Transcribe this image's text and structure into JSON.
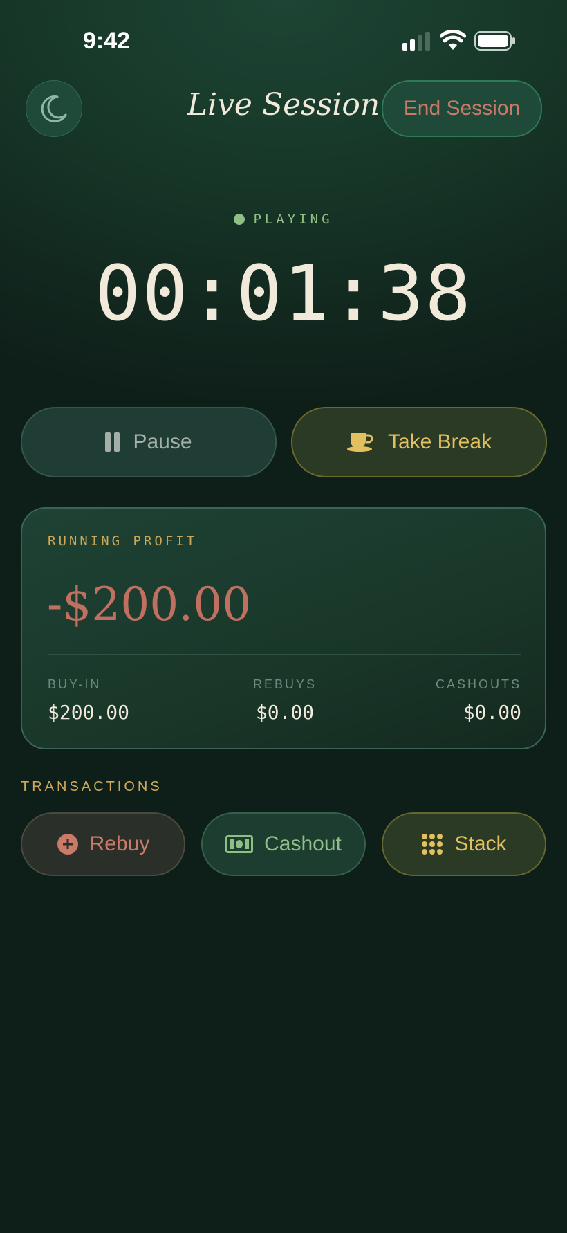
{
  "status_bar": {
    "time": "9:42"
  },
  "header": {
    "title": "Live Session",
    "end_label": "End Session"
  },
  "session": {
    "status": "PLAYING",
    "timer": "00:01:38"
  },
  "actions": {
    "pause_label": "Pause",
    "break_label": "Take Break"
  },
  "profit_card": {
    "label": "RUNNING PROFIT",
    "value": "-$200.00",
    "stats": [
      {
        "label": "BUY-IN",
        "value": "$200.00"
      },
      {
        "label": "REBUYS",
        "value": "$0.00"
      },
      {
        "label": "CASHOUTS",
        "value": "$0.00"
      }
    ]
  },
  "transactions": {
    "label": "TRANSACTIONS",
    "buttons": [
      {
        "label": "Rebuy",
        "icon": "plus-circle-icon"
      },
      {
        "label": "Cashout",
        "icon": "banknote-icon"
      },
      {
        "label": "Stack",
        "icon": "grid-dots-icon"
      }
    ]
  },
  "colors": {
    "background": "#173829",
    "accent_gold": "#cfa85a",
    "negative": "#c07060",
    "positive_green": "#8fbf85"
  }
}
